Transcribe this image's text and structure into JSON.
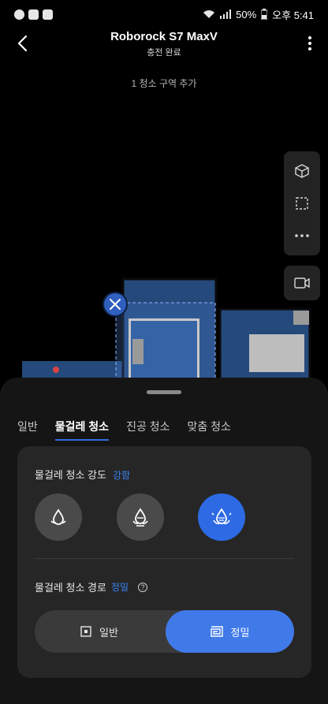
{
  "status_bar": {
    "battery": "50%",
    "time": "오후 5:41"
  },
  "header": {
    "title": "Roborock S7 MaxV",
    "subtitle": "충전 완료"
  },
  "zone_hint": "1 청소 구역 추가",
  "tabs": [
    {
      "label": "일반",
      "active": false
    },
    {
      "label": "물걸레 청소",
      "active": true
    },
    {
      "label": "진공 청소",
      "active": false
    },
    {
      "label": "맞춤 청소",
      "active": false
    }
  ],
  "mop_intensity": {
    "label": "물걸레 청소 강도",
    "value": "강함",
    "levels": [
      "low",
      "medium",
      "high"
    ],
    "selected_level": "high"
  },
  "mop_route": {
    "label": "물걸레 청소 경로",
    "value": "정밀",
    "options": [
      {
        "label": "일반",
        "selected": false
      },
      {
        "label": "정밀",
        "selected": true
      }
    ]
  },
  "colors": {
    "accent": "#3a82f7",
    "map_floor": "#24497a",
    "sheet_bg": "#151515",
    "card_bg": "#262626"
  }
}
